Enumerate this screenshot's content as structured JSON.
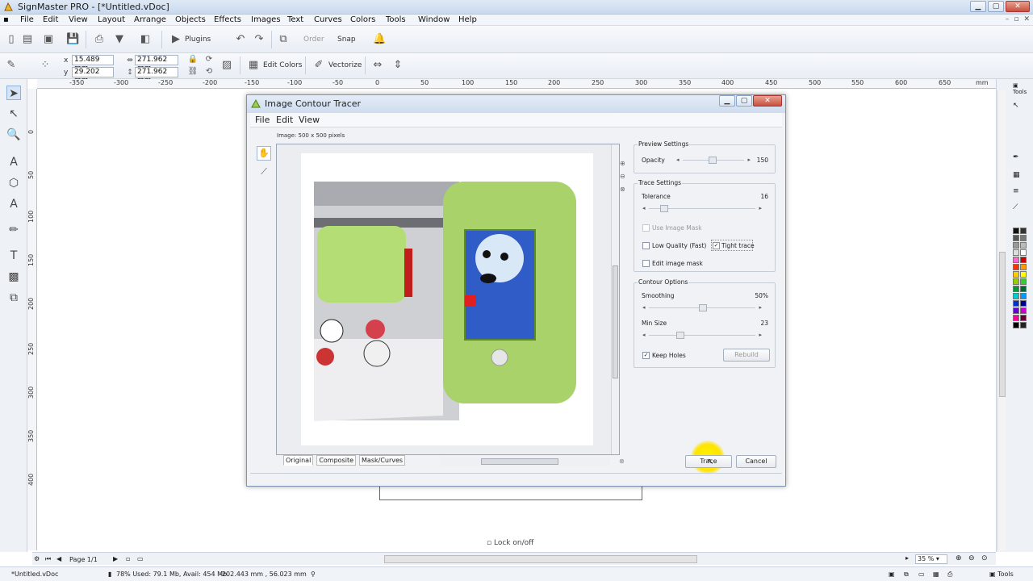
{
  "window": {
    "title": "SignMaster PRO - [*Untitled.vDoc]"
  },
  "menu": [
    "File",
    "Edit",
    "View",
    "Layout",
    "Arrange",
    "Objects",
    "Effects",
    "Images",
    "Text",
    "Curves",
    "Colors",
    "Tools",
    "Window",
    "Help"
  ],
  "toolbar": {
    "plugins": "Plugins",
    "order": "Order",
    "snap": "Snap",
    "edit_colors": "Edit Colors",
    "vectorize": "Vectorize"
  },
  "coords": {
    "x_label": "x",
    "y_label": "y",
    "x": "15.489 mm",
    "y": "29.202 mm",
    "w": "271.962 mm",
    "h": "271.962 mm"
  },
  "ruler": {
    "h": [
      "-350",
      "-300",
      "-250",
      "-200",
      "-150",
      "-100",
      "-50",
      "0",
      "50",
      "100",
      "150",
      "200",
      "250",
      "300",
      "350",
      "400",
      "450",
      "500",
      "550",
      "600",
      "650",
      "mm"
    ],
    "v": [
      "0",
      "50",
      "100",
      "150",
      "200",
      "250",
      "300",
      "350",
      "400"
    ]
  },
  "dialog": {
    "title": "Image Contour Tracer",
    "menu": [
      "File",
      "Edit",
      "View"
    ],
    "image_info": "Image: 500 x 500 pixels",
    "tabs": [
      "Original",
      "Composite",
      "Mask/Curves"
    ],
    "preview": {
      "title": "Preview Settings",
      "opacity_label": "Opacity",
      "opacity": "150"
    },
    "trace": {
      "title": "Trace Settings",
      "tolerance_label": "Tolerance",
      "tolerance": "16",
      "use_image_mask": "Use Image Mask",
      "low_quality": "Low Quality (Fast)",
      "tight_trace": "Tight trace",
      "edit_mask": "Edit image mask"
    },
    "contour": {
      "title": "Contour Options",
      "smoothing_label": "Smoothing",
      "smoothing": "50%",
      "min_size_label": "Min Size",
      "min_size": "23",
      "keep_holes": "Keep Holes",
      "rebuild": "Rebuild"
    },
    "trace_button": "Trace",
    "cancel_button": "Cancel"
  },
  "lock": "Lock on/off",
  "page_nav": "Page 1/1",
  "zoom": "35 %",
  "status": {
    "doc": "*Untitled.vDoc",
    "mem": "78%  Used: 79.1 Mb, Avail: 454 Mb",
    "pos": "-202.443 mm , 56.023 mm",
    "tools": "Tools"
  },
  "right_panel": {
    "tools_label": "Tools"
  },
  "palette": [
    "#111111",
    "#333333",
    "#555555",
    "#777777",
    "#999999",
    "#bbbbbb",
    "#dddddd",
    "#ffffff",
    "#ff66cc",
    "#cc0000",
    "#ff3300",
    "#ff9900",
    "#ffcc00",
    "#ffff00",
    "#99cc00",
    "#33cc33",
    "#009933",
    "#006633",
    "#00cccc",
    "#0099ff",
    "#0033cc",
    "#000099",
    "#6600cc",
    "#cc00cc",
    "#ff0099",
    "#660033",
    "#000000",
    "#222222"
  ]
}
